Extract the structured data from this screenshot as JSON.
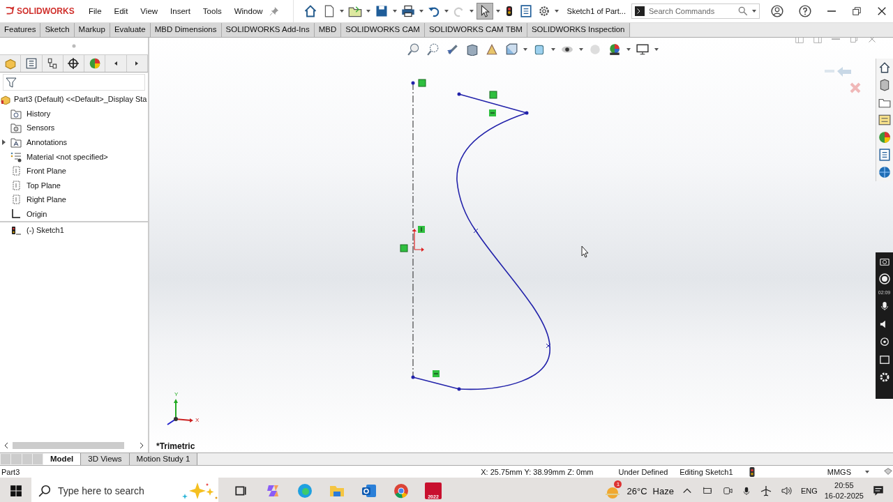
{
  "app": {
    "name": "SOLIDWORKS"
  },
  "menu": [
    "File",
    "Edit",
    "View",
    "Insert",
    "Tools",
    "Window"
  ],
  "document_title": "Sketch1 of Part...",
  "search": {
    "placeholder": "Search Commands"
  },
  "command_tabs": [
    {
      "label": "Features",
      "selected": false
    },
    {
      "label": "Sketch",
      "selected": false
    },
    {
      "label": "Markup",
      "selected": false
    },
    {
      "label": "Evaluate",
      "selected": false
    },
    {
      "label": "MBD Dimensions",
      "selected": false
    },
    {
      "label": "SOLIDWORKS Add-Ins",
      "selected": false
    },
    {
      "label": "MBD",
      "selected": false
    },
    {
      "label": "SOLIDWORKS CAM",
      "selected": false
    },
    {
      "label": "SOLIDWORKS CAM TBM",
      "selected": false
    },
    {
      "label": "SOLIDWORKS Inspection",
      "selected": false
    }
  ],
  "feature_tree": {
    "root": "Part3 (Default) <<Default>_Display Sta",
    "items": [
      {
        "label": "History",
        "kind": "history",
        "expandable": false
      },
      {
        "label": "Sensors",
        "kind": "sensors",
        "expandable": false
      },
      {
        "label": "Annotations",
        "kind": "annotations",
        "expandable": true
      },
      {
        "label": "Material <not specified>",
        "kind": "material",
        "expandable": false
      },
      {
        "label": "Front Plane",
        "kind": "plane",
        "expandable": false
      },
      {
        "label": "Top Plane",
        "kind": "plane",
        "expandable": false
      },
      {
        "label": "Right Plane",
        "kind": "plane",
        "expandable": false
      },
      {
        "label": "Origin",
        "kind": "origin",
        "expandable": false
      },
      {
        "label": "(-) Sketch1",
        "kind": "sketch",
        "expandable": false
      }
    ]
  },
  "viewport": {
    "view_name": "*Trimetric",
    "triad": {
      "x_label": "X",
      "y_label": "Y"
    }
  },
  "recorder": {
    "time": "02:09"
  },
  "bottom_tabs": [
    {
      "label": "Model",
      "selected": true
    },
    {
      "label": "3D Views",
      "selected": false
    },
    {
      "label": "Motion Study 1",
      "selected": false
    }
  ],
  "status_bar": {
    "document": "Part3",
    "coordinates": "X: 25.75mm Y: 38.99mm Z: 0mm",
    "sketch_state": "Under Defined",
    "mode": "Editing Sketch1",
    "units": "MMGS"
  },
  "taskbar": {
    "search_placeholder": "Type here to search",
    "apps": [
      {
        "kind": "taskview"
      },
      {
        "kind": "copilot"
      },
      {
        "kind": "edge"
      },
      {
        "kind": "explorer"
      },
      {
        "kind": "outlook"
      },
      {
        "kind": "chrome"
      },
      {
        "kind": "solidworks",
        "label": "2022"
      }
    ],
    "weather": {
      "badge": "1",
      "temperature": "26°C",
      "condition": "Haze"
    },
    "language": "ENG",
    "time": "20:55",
    "date": "16-02-2025"
  }
}
